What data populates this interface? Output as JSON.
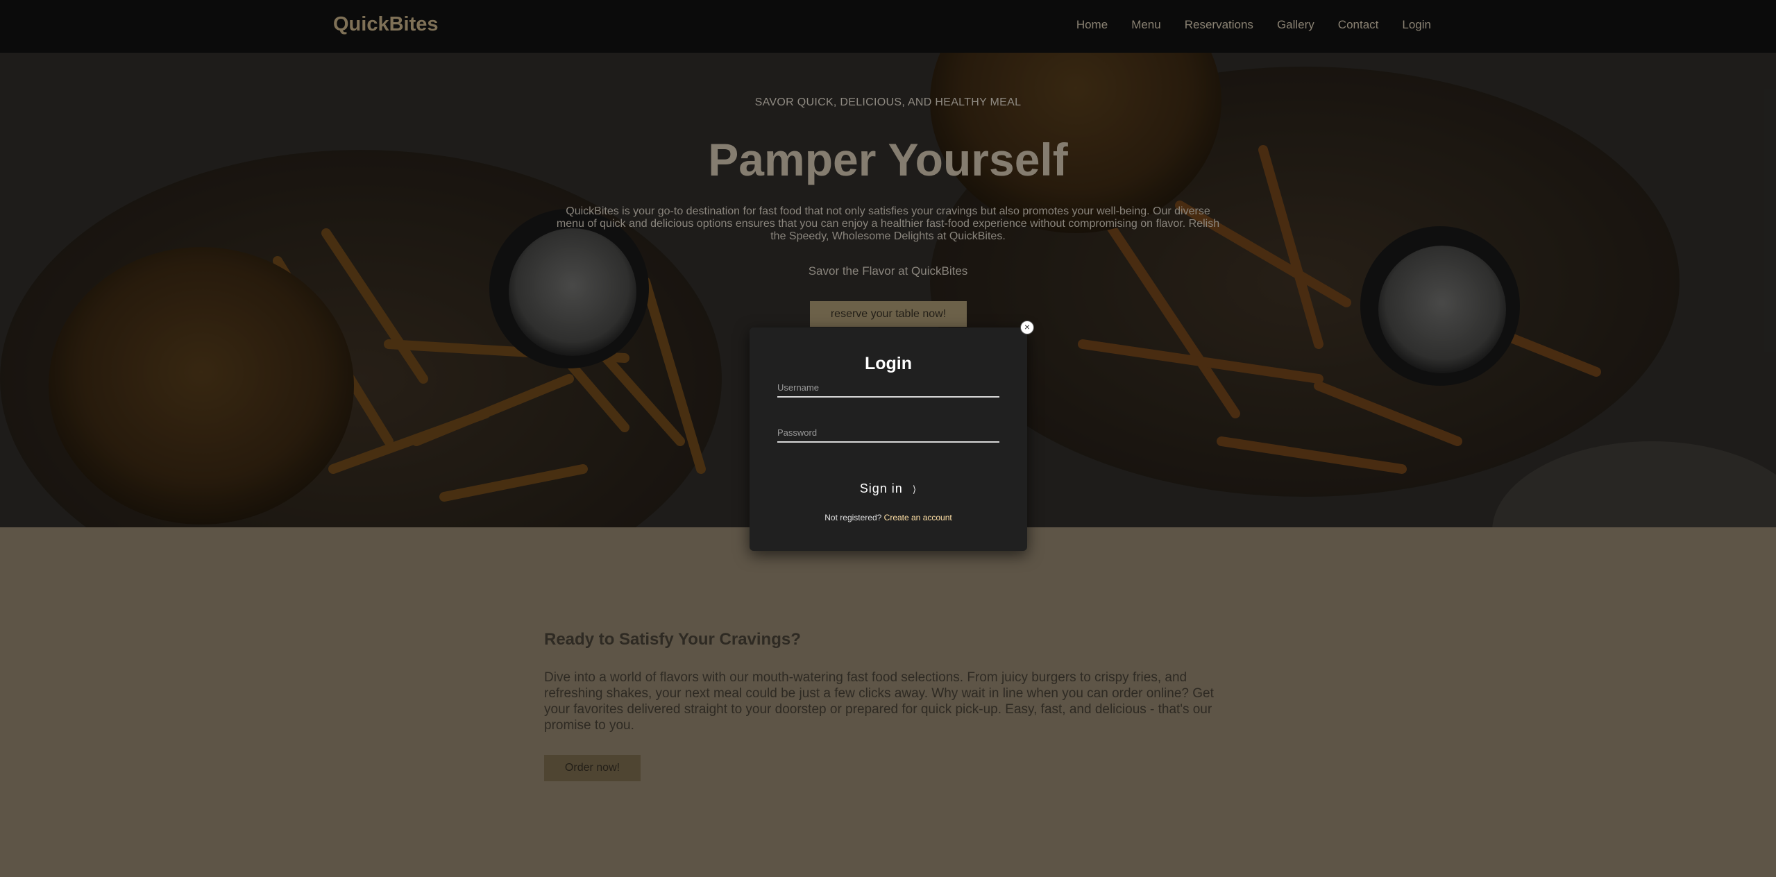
{
  "brand": "QuickBites",
  "nav": {
    "items": [
      "Home",
      "Menu",
      "Reservations",
      "Gallery",
      "Contact",
      "Login"
    ]
  },
  "hero": {
    "eyebrow": "SAVOR QUICK, DELICIOUS, AND HEALTHY MEAL",
    "title": "Pamper Yourself",
    "description": "QuickBites is your go-to destination for fast food that not only satisfies your cravings but also promotes your well-being. Our diverse menu of quick and delicious options ensures that you can enjoy a healthier fast-food experience without compromising on flavor. Relish the Speedy, Wholesome Delights at QuickBites.",
    "tagline": "Savor the Flavor at QuickBites",
    "cta": "reserve your table now!"
  },
  "section": {
    "title": "Ready to Satisfy Your Cravings?",
    "text": "Dive into a world of flavors with our mouth-watering fast food selections. From juicy burgers to crispy fries, and refreshing shakes, your next meal could be just a few clicks away. Why wait in line when you can order online? Get your favorites delivered straight to your doorstep or prepared for quick pick-up. Easy, fast, and delicious - that's our promise to you.",
    "cta": "Order now!"
  },
  "modal": {
    "title": "Login",
    "username_placeholder": "Username",
    "password_placeholder": "Password",
    "signin": "Sign in",
    "signin_arrow": "⟩",
    "register_prompt": "Not registered?",
    "register_link": "Create an account",
    "close": "×"
  },
  "colors": {
    "navbar": "#0b0b0b",
    "brand": "#7f7157",
    "accent_button": "#6c6149",
    "page_background": "#5e5547",
    "modal_background": "#202020",
    "link": "#ffe0a6"
  }
}
